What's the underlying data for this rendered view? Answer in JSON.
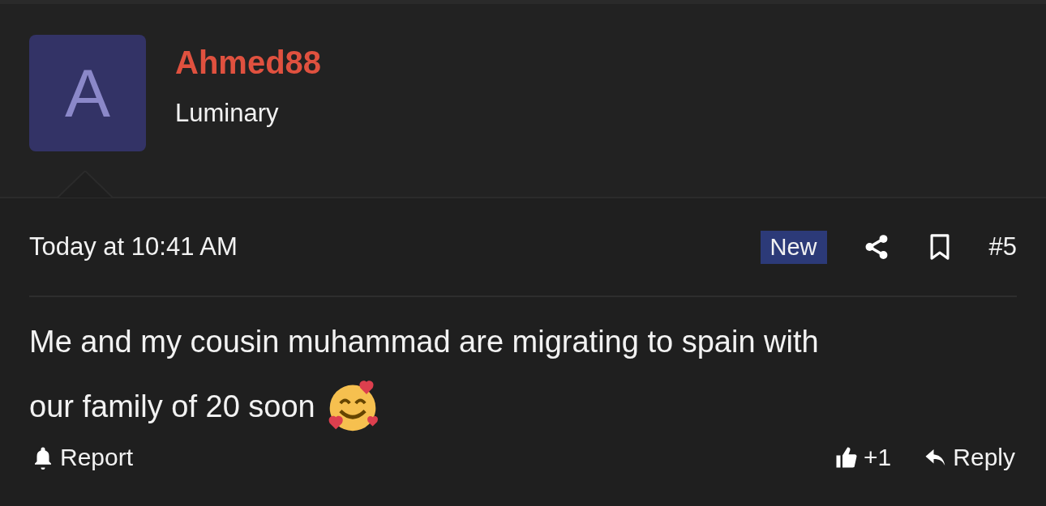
{
  "author": {
    "avatar_letter": "A",
    "name": "Ahmed88",
    "title": "Luminary"
  },
  "post": {
    "date": "Today at 10:41 AM",
    "badge": "New",
    "number": "#5",
    "body_lines": [
      "Me and my cousin muhammad are migrating to spain with",
      "our family of 20 soon"
    ]
  },
  "actions_left": [
    {
      "kind": "report",
      "label": "Report"
    }
  ],
  "actions_right": [
    {
      "kind": "like",
      "label": "+1"
    },
    {
      "kind": "reply",
      "label": "Reply"
    }
  ]
}
